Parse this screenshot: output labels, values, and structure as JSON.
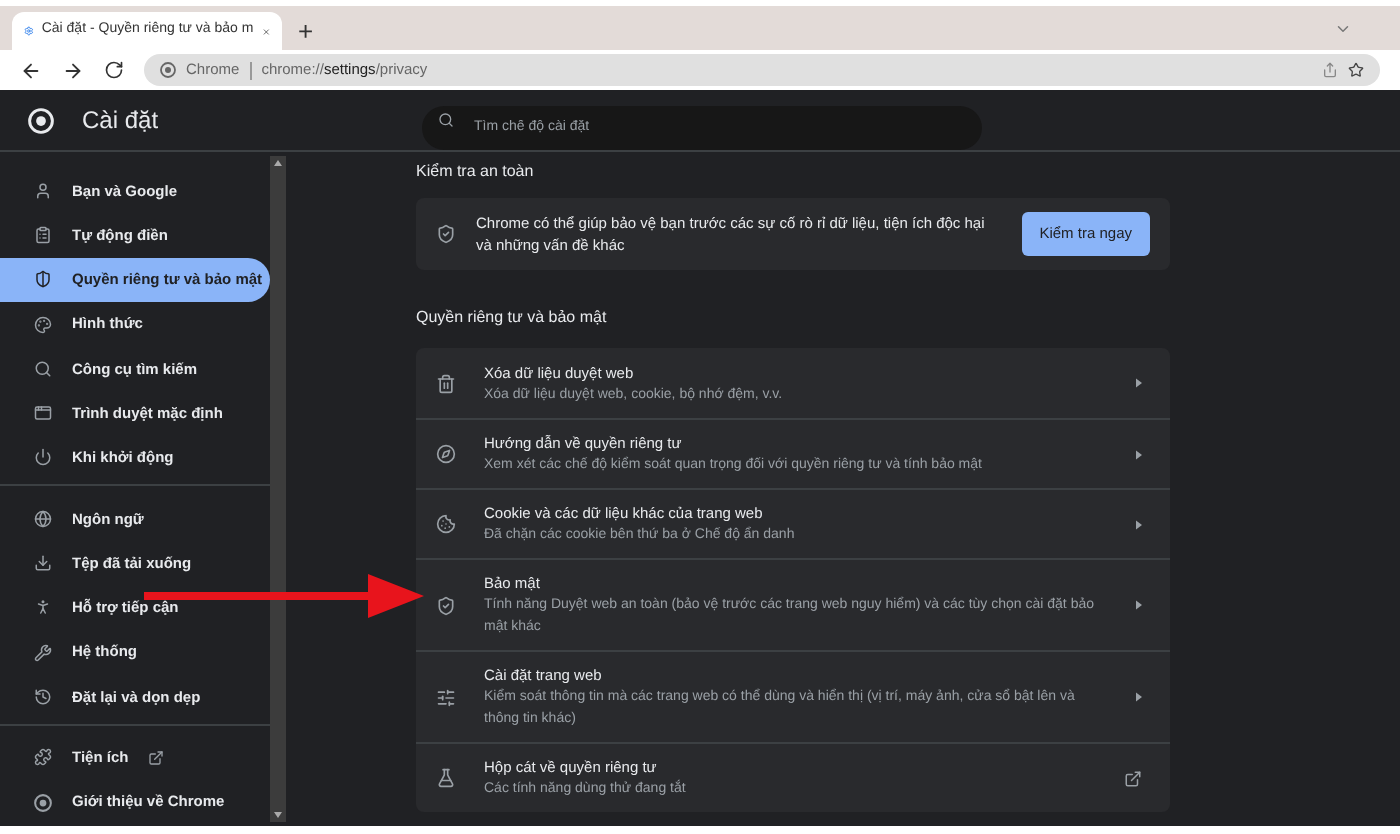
{
  "browser": {
    "tab_title": "Cài đặt - Quyền riêng tư và bảo m",
    "new_tab": "+",
    "address_label": "Chrome",
    "url_host": "chrome://",
    "url_path_bold": "settings",
    "url_rest": "/privacy"
  },
  "header": {
    "title": "Cài đặt",
    "search_placeholder": "Tìm chế độ cài đặt"
  },
  "sidebar": {
    "groups": [
      [
        {
          "label": "Bạn và Google",
          "selected": false
        },
        {
          "label": "Tự động điền",
          "selected": false
        },
        {
          "label": "Quyền riêng tư và bảo mật",
          "selected": true
        },
        {
          "label": "Hình thức",
          "selected": false
        },
        {
          "label": "Công cụ tìm kiếm",
          "selected": false
        },
        {
          "label": "Trình duyệt mặc định",
          "selected": false
        },
        {
          "label": "Khi khởi động",
          "selected": false
        }
      ],
      [
        {
          "label": "Ngôn ngữ",
          "selected": false
        },
        {
          "label": "Tệp đã tải xuống",
          "selected": false
        },
        {
          "label": "Hỗ trợ tiếp cận",
          "selected": false
        },
        {
          "label": "Hệ thống",
          "selected": false
        },
        {
          "label": "Đặt lại và dọn dẹp",
          "selected": false
        }
      ],
      [
        {
          "label": "Tiện ích",
          "external": true,
          "selected": false
        },
        {
          "label": "Giới thiệu về Chrome",
          "external": false,
          "selected": false
        }
      ]
    ]
  },
  "safety_check": {
    "heading": "Kiểm tra an toàn",
    "text": "Chrome có thể giúp bảo vệ bạn trước các sự cố rò rỉ dữ liệu, tiện ích độc hại và những vấn đề khác",
    "button": "Kiểm tra ngay"
  },
  "privacy": {
    "heading": "Quyền riêng tư và bảo mật",
    "rows": [
      {
        "title": "Xóa dữ liệu duyệt web",
        "description": "Xóa dữ liệu duyệt web, cookie, bộ nhớ đệm, v.v.",
        "kind": "arrow"
      },
      {
        "title": "Hướng dẫn về quyền riêng tư",
        "description": "Xem xét các chế độ kiểm soát quan trọng đối với quyền riêng tư và tính bảo mật",
        "kind": "arrow"
      },
      {
        "title": "Cookie và các dữ liệu khác của trang web",
        "description": "Đã chặn các cookie bên thứ ba ở Chế độ ẩn danh",
        "kind": "arrow"
      },
      {
        "title": "Bảo mật",
        "description": "Tính năng Duyệt web an toàn (bảo vệ trước các trang web nguy hiểm) và các tùy chọn cài đặt bảo mật khác",
        "kind": "arrow"
      },
      {
        "title": "Cài đặt trang web",
        "description": "Kiểm soát thông tin mà các trang web có thể dùng và hiển thị (vị trí, máy ảnh, cửa sổ bật lên và thông tin khác)",
        "kind": "arrow"
      },
      {
        "title": "Hộp cát về quyền riêng tư",
        "description": "Các tính năng dùng thử đang tắt",
        "kind": "external"
      }
    ]
  }
}
